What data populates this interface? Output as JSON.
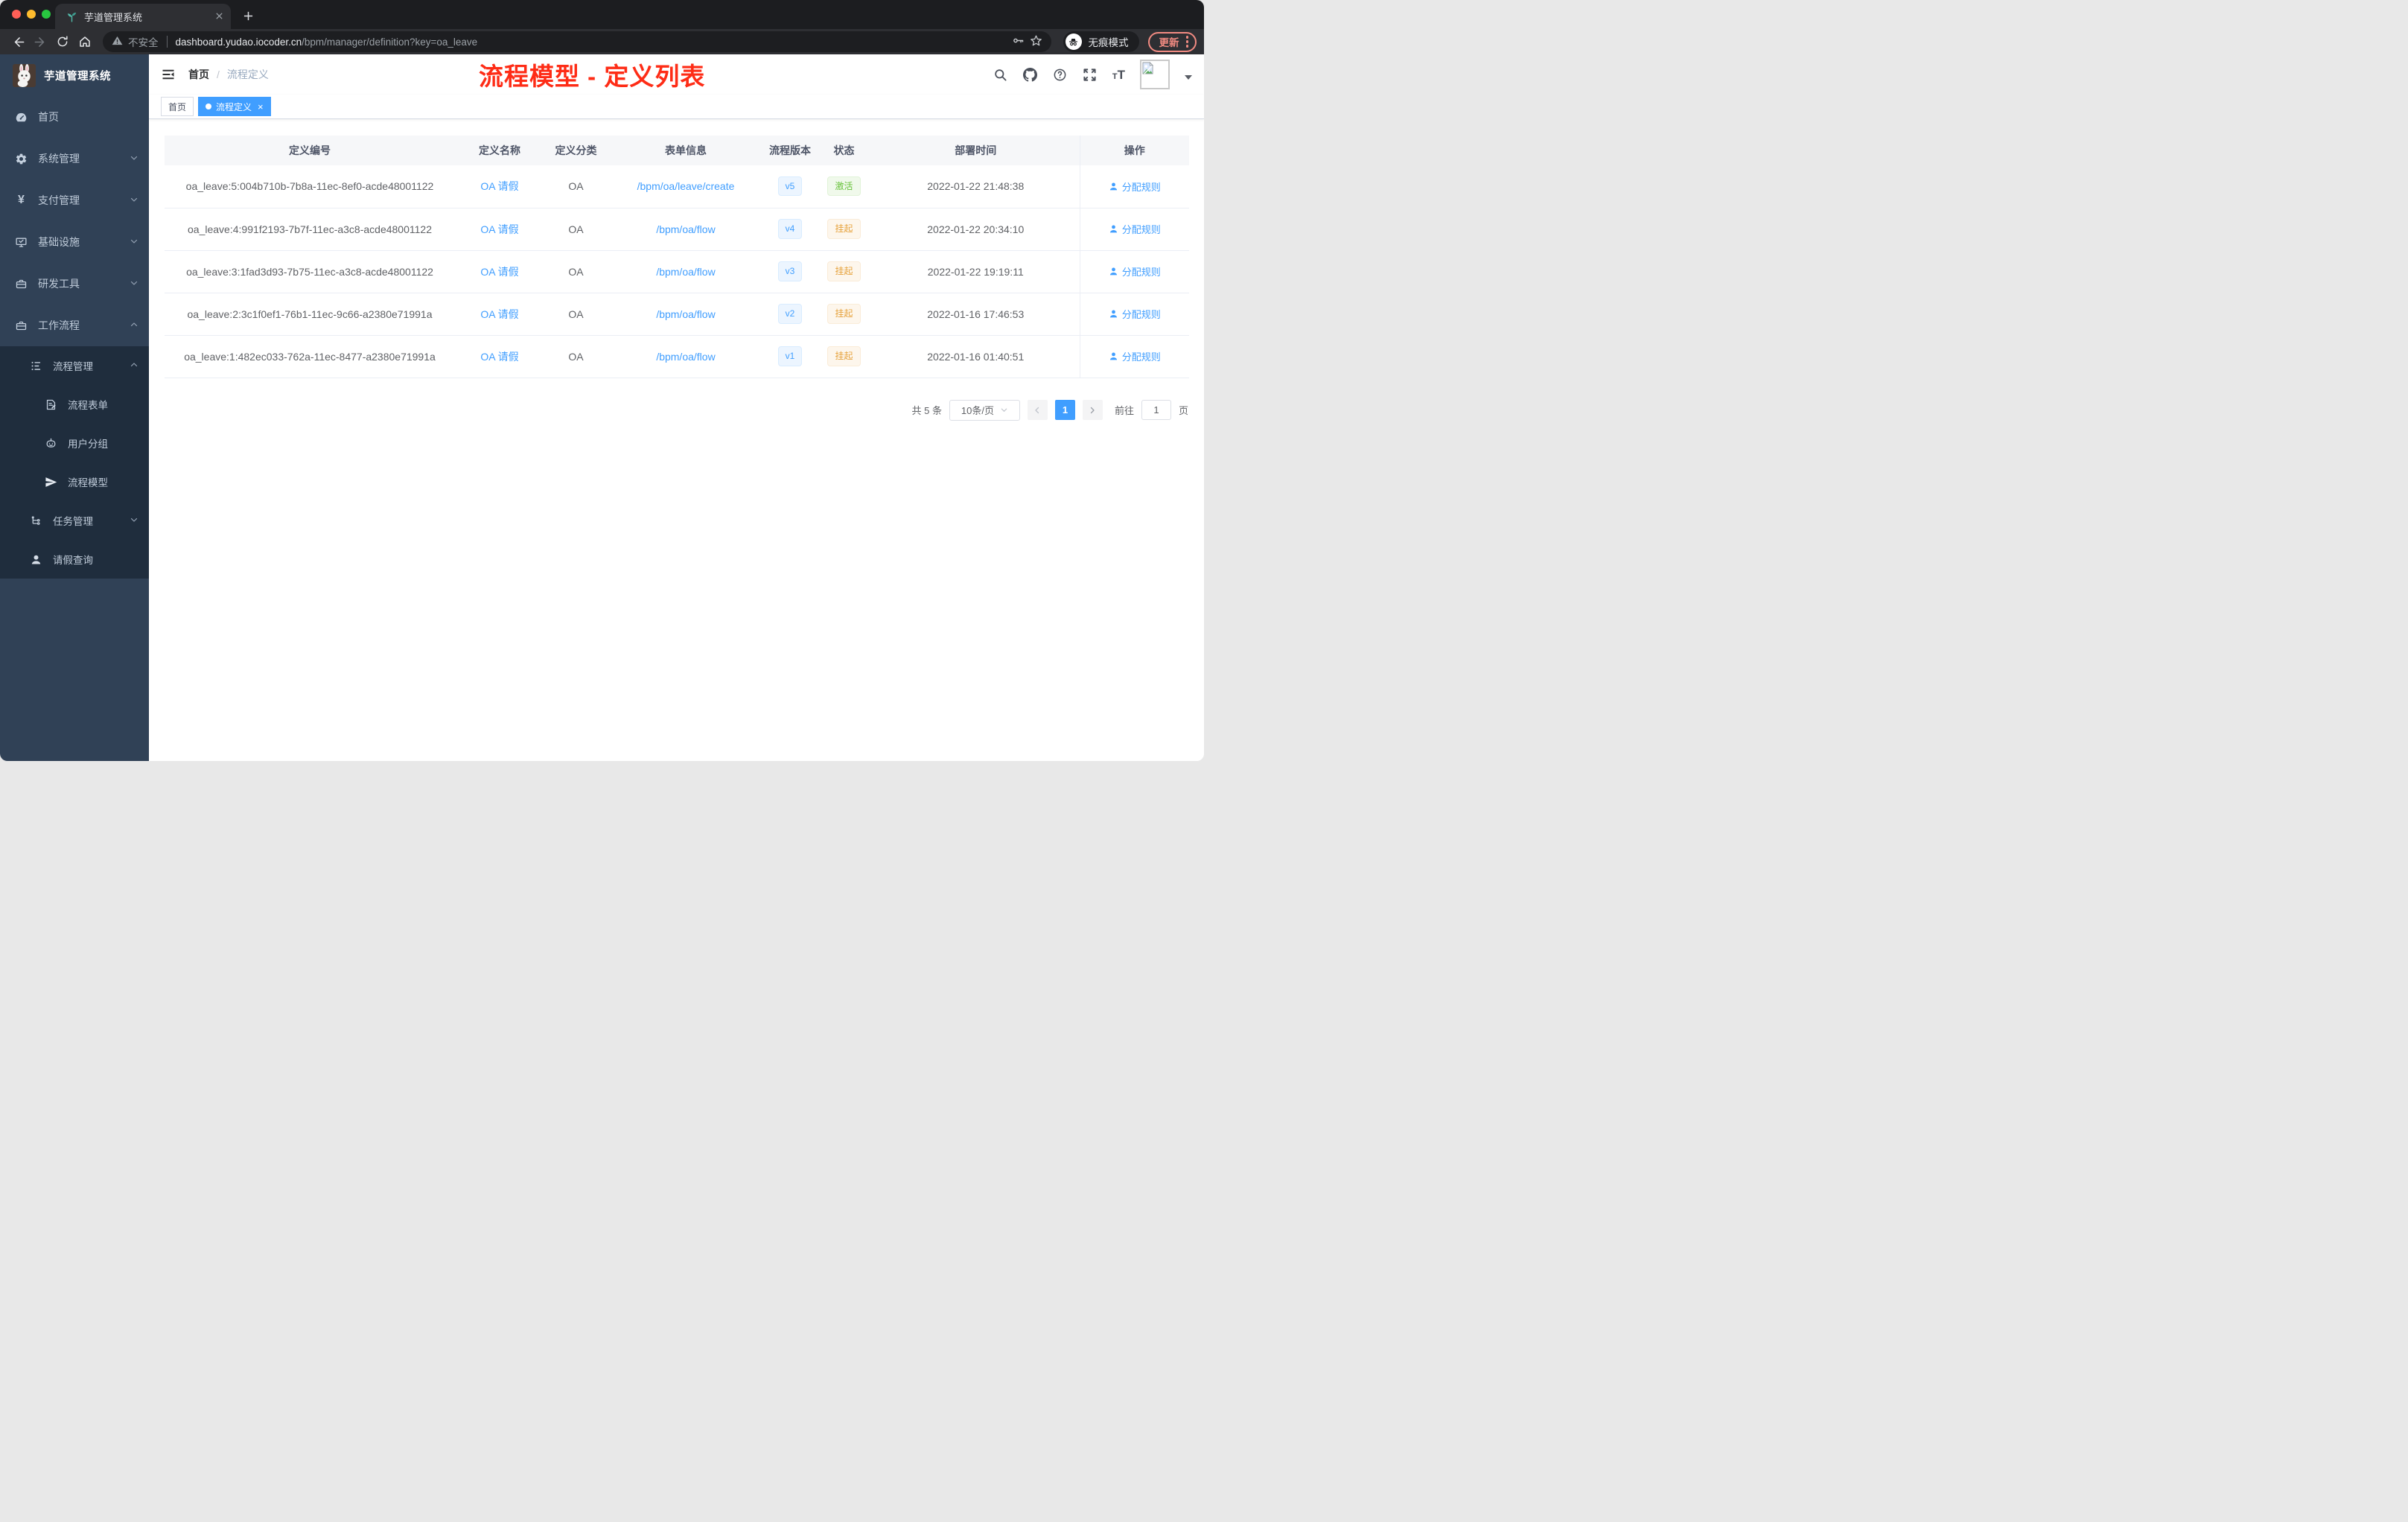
{
  "browser": {
    "tab_title": "芋道管理系统",
    "security_label": "不安全",
    "url_domain": "dashboard.yudao.iocoder.cn",
    "url_path": "/bpm/manager/definition?key=oa_leave",
    "incognito_label": "无痕模式",
    "update_label": "更新"
  },
  "sidebar": {
    "app_title": "芋道管理系统",
    "items": [
      {
        "label": "首页",
        "icon": "dashboard-icon"
      },
      {
        "label": "系统管理",
        "icon": "gear-icon",
        "chevron": "down"
      },
      {
        "label": "支付管理",
        "icon": "yen-icon",
        "chevron": "down"
      },
      {
        "label": "基础设施",
        "icon": "monitor-icon",
        "chevron": "down"
      },
      {
        "label": "研发工具",
        "icon": "toolbox-icon",
        "chevron": "down"
      },
      {
        "label": "工作流程",
        "icon": "briefcase-icon",
        "chevron": "up"
      }
    ],
    "submenu": [
      {
        "label": "流程管理",
        "icon": "list-tree-icon",
        "chevron": "up",
        "level": 2
      },
      {
        "label": "流程表单",
        "icon": "form-icon",
        "level": 3
      },
      {
        "label": "用户分组",
        "icon": "robot-icon",
        "level": 3
      },
      {
        "label": "流程模型",
        "icon": "paper-plane-icon",
        "level": 3
      },
      {
        "label": "任务管理",
        "icon": "tree-icon",
        "chevron": "down",
        "level": 2
      },
      {
        "label": "请假查询",
        "icon": "user-icon",
        "level": 2
      }
    ]
  },
  "navbar": {
    "breadcrumb": [
      "首页",
      "流程定义"
    ],
    "breadcrumb_separator": "/",
    "annotation": "流程模型 - 定义列表",
    "annotation_color": "#fe2c16"
  },
  "tags": [
    {
      "label": "首页",
      "active": false
    },
    {
      "label": "流程定义",
      "active": true,
      "closable": true
    }
  ],
  "table": {
    "columns": [
      "定义编号",
      "定义名称",
      "定义分类",
      "表单信息",
      "流程版本",
      "状态",
      "部署时间",
      "操作"
    ],
    "rows": [
      {
        "id": "oa_leave:5:004b710b-7b8a-11ec-8ef0-acde48001122",
        "name": "OA 请假",
        "category": "OA",
        "form": "/bpm/oa/leave/create",
        "version": "v5",
        "status": "激活",
        "status_type": "success",
        "deploy_time": "2022-01-22 21:48:38",
        "action": "分配规则"
      },
      {
        "id": "oa_leave:4:991f2193-7b7f-11ec-a3c8-acde48001122",
        "name": "OA 请假",
        "category": "OA",
        "form": "/bpm/oa/flow",
        "version": "v4",
        "status": "挂起",
        "status_type": "warning",
        "deploy_time": "2022-01-22 20:34:10",
        "action": "分配规则"
      },
      {
        "id": "oa_leave:3:1fad3d93-7b75-11ec-a3c8-acde48001122",
        "name": "OA 请假",
        "category": "OA",
        "form": "/bpm/oa/flow",
        "version": "v3",
        "status": "挂起",
        "status_type": "warning",
        "deploy_time": "2022-01-22 19:19:11",
        "action": "分配规则"
      },
      {
        "id": "oa_leave:2:3c1f0ef1-76b1-11ec-9c66-a2380e71991a",
        "name": "OA 请假",
        "category": "OA",
        "form": "/bpm/oa/flow",
        "version": "v2",
        "status": "挂起",
        "status_type": "warning",
        "deploy_time": "2022-01-16 17:46:53",
        "action": "分配规则"
      },
      {
        "id": "oa_leave:1:482ec033-762a-11ec-8477-a2380e71991a",
        "name": "OA 请假",
        "category": "OA",
        "form": "/bpm/oa/flow",
        "version": "v1",
        "status": "挂起",
        "status_type": "warning",
        "deploy_time": "2022-01-16 01:40:51",
        "action": "分配规则"
      }
    ]
  },
  "pagination": {
    "total": "共 5 条",
    "page_size": "10条/页",
    "current_page": "1",
    "goto_label": "前往",
    "goto_value": "1",
    "page_unit": "页"
  },
  "colors": {
    "accent_blue": "#409eff",
    "status_active_green": "#67c23a",
    "status_suspended_orange": "#e6a23c",
    "sidebar_bg": "#304156",
    "submenu_bg": "#1f2d3d",
    "annotation_red": "#fe2c16",
    "chrome_update_red": "#f28b82"
  }
}
